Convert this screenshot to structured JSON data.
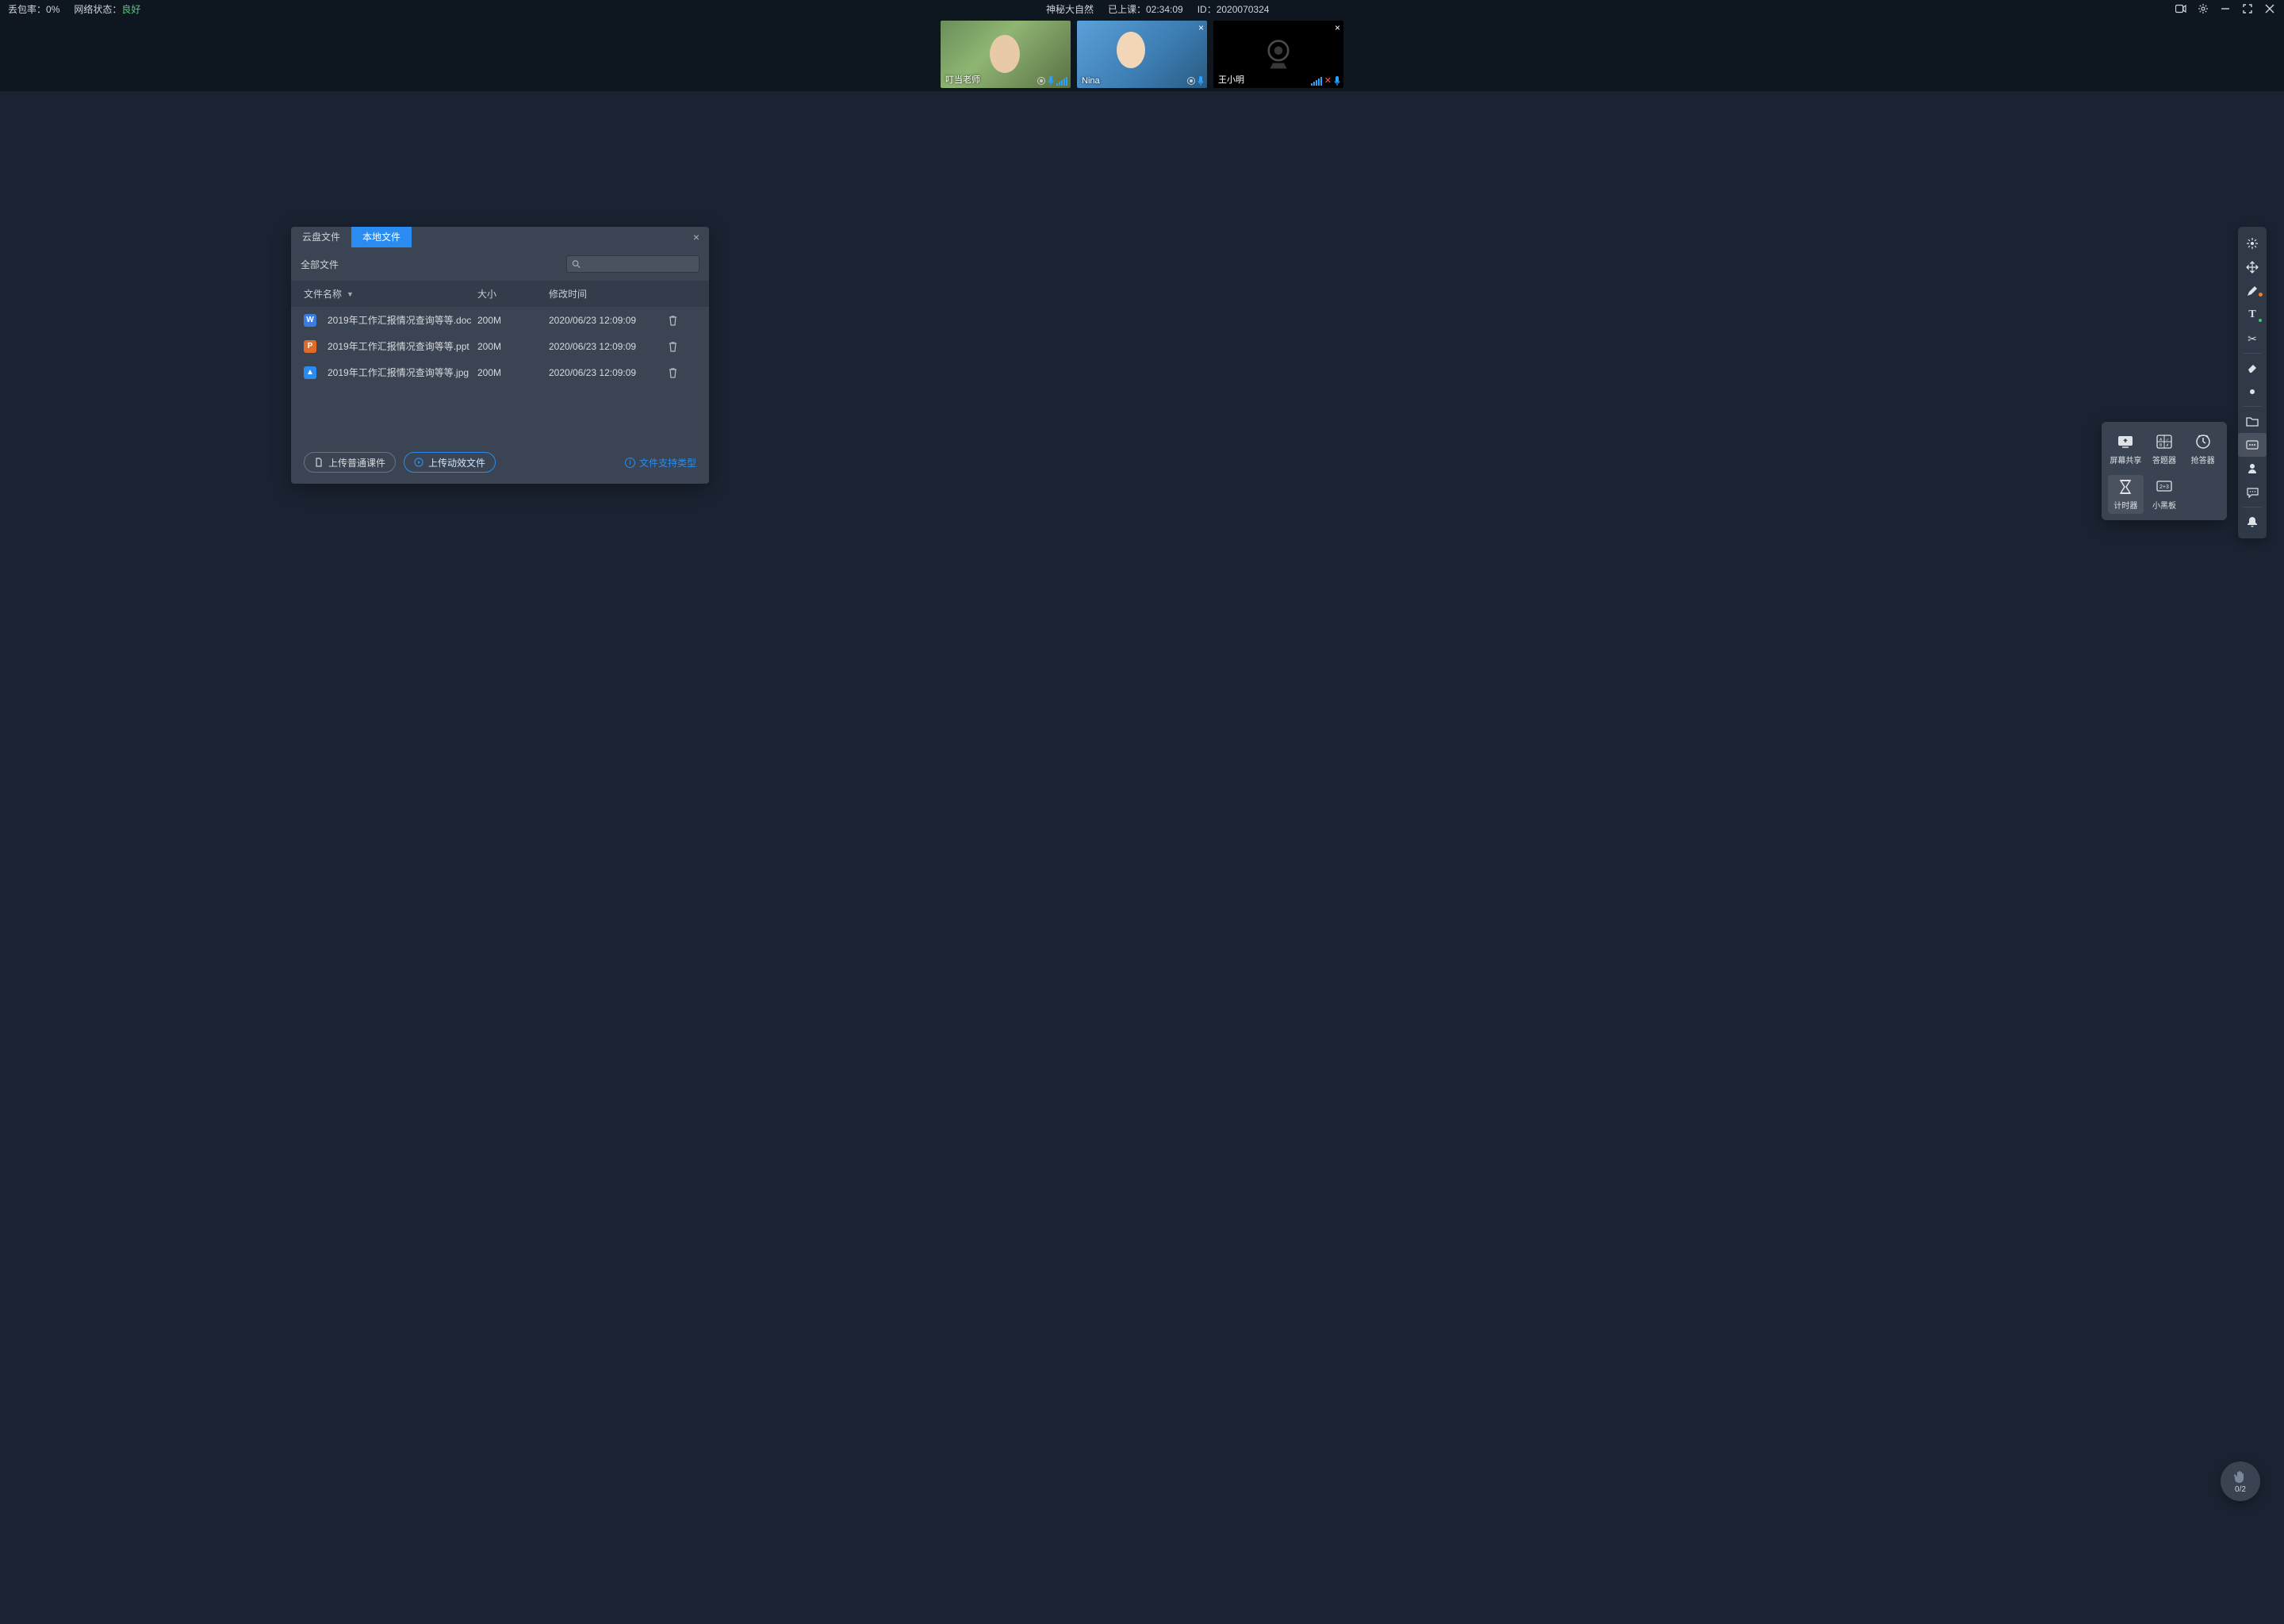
{
  "status": {
    "packet_loss_label": "丢包率：",
    "packet_loss_value": "0%",
    "network_label": "网络状态：",
    "network_value": "良好",
    "title": "神秘大自然",
    "elapsed_label": "已上课：",
    "elapsed_value": "02:34:09",
    "id_label": "ID：",
    "id_value": "2020070324"
  },
  "videos": [
    {
      "name": "叮当老师"
    },
    {
      "name": "Nina"
    },
    {
      "name": "王小明"
    }
  ],
  "dialog": {
    "tabs": {
      "cloud": "云盘文件",
      "local": "本地文件"
    },
    "all_files": "全部文件",
    "columns": {
      "name": "文件名称",
      "size": "大小",
      "mtime": "修改时间"
    },
    "rows": [
      {
        "icon": "W",
        "cls": "doc",
        "name": "2019年工作汇报情况查询等等.doc",
        "size": "200M",
        "mtime": "2020/06/23 12:09:09"
      },
      {
        "icon": "P",
        "cls": "ppt",
        "name": "2019年工作汇报情况查询等等.ppt",
        "size": "200M",
        "mtime": "2020/06/23 12:09:09"
      },
      {
        "icon": "▲",
        "cls": "jpg",
        "name": "2019年工作汇报情况查询等等.jpg",
        "size": "200M",
        "mtime": "2020/06/23 12:09:09"
      }
    ],
    "upload_normal": "上传普通课件",
    "upload_anim": "上传动效文件",
    "file_types": "文件支持类型"
  },
  "tools": {
    "screen_share": "屏幕共享",
    "answer_tool": "答题器",
    "buzzer": "抢答器",
    "timer": "计时器",
    "blackboard": "小黑板"
  },
  "hand": {
    "count": "0/2"
  }
}
